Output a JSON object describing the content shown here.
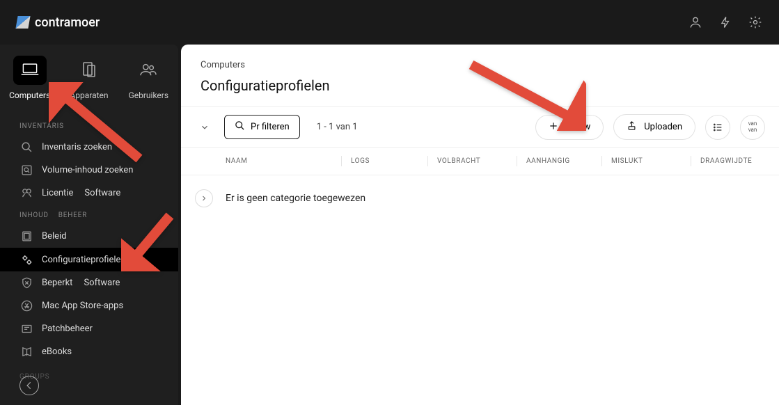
{
  "brand": {
    "name": "contramoer"
  },
  "siderail": {
    "items": [
      {
        "label": "Computers",
        "icon": "laptop-icon",
        "active": true
      },
      {
        "label": "Apparaten",
        "icon": "device-icon",
        "active": false
      },
      {
        "label": "Gebruikers",
        "icon": "users-icon",
        "active": false
      }
    ]
  },
  "sections": {
    "inventaris": "INVENTARIS",
    "inhoud": "INHOUD",
    "beheer": "BEHEER",
    "groups": "GROUPS"
  },
  "nav": {
    "inventaris_zoeken": "Inventaris zoeken",
    "volume_inhoud_zoeken": "Volume-inhoud zoeken",
    "licentie": "Licentie",
    "software1": "Software",
    "beleid": "Beleid",
    "configuratieprofielen": "Configuratieprofielen",
    "beperkt": "Beperkt",
    "software2": "Software",
    "mac_app_store": "Mac App Store-apps",
    "patchbeheer": "Patchbeheer",
    "ebooks": "eBooks"
  },
  "breadcrumb": "Computers",
  "page_title": "Configuratieprofielen",
  "toolbar": {
    "filter_label": "Pr filteren",
    "range": "1 - 1 van 1",
    "nieuw": "Nieuw",
    "uploaden": "Uploaden",
    "van": "van"
  },
  "columns": {
    "naam": "NAAM",
    "logs": "LOGS",
    "volbracht": "VOLBRACHT",
    "aanhangig": "AANHANGIG",
    "mislukt": "MISLUKT",
    "draagwijdte": "DRAAGWIJDTE"
  },
  "empty_row": "Er is geen categorie toegewezen",
  "accent": "#e24b3a"
}
